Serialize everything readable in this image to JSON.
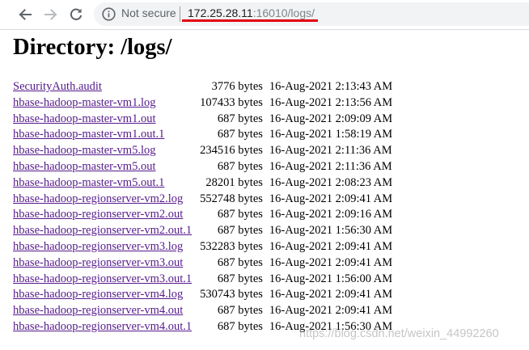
{
  "browser": {
    "security_label": "Not secure",
    "url_host": "172.25.28.11",
    "url_rest": ":16010/logs/"
  },
  "page": {
    "title": "Directory: /logs/"
  },
  "files": [
    {
      "name": "SecurityAuth.audit",
      "size": "3776 bytes",
      "date": "16-Aug-2021 2:13:43 AM"
    },
    {
      "name": "hbase-hadoop-master-vm1.log",
      "size": "107433 bytes",
      "date": "16-Aug-2021 2:13:56 AM"
    },
    {
      "name": "hbase-hadoop-master-vm1.out",
      "size": "687 bytes",
      "date": "16-Aug-2021 2:09:09 AM"
    },
    {
      "name": "hbase-hadoop-master-vm1.out.1",
      "size": "687 bytes",
      "date": "16-Aug-2021 1:58:19 AM"
    },
    {
      "name": "hbase-hadoop-master-vm5.log",
      "size": "234516 bytes",
      "date": "16-Aug-2021 2:11:36 AM"
    },
    {
      "name": "hbase-hadoop-master-vm5.out",
      "size": "687 bytes",
      "date": "16-Aug-2021 2:11:36 AM"
    },
    {
      "name": "hbase-hadoop-master-vm5.out.1",
      "size": "28201 bytes",
      "date": "16-Aug-2021 2:08:23 AM"
    },
    {
      "name": "hbase-hadoop-regionserver-vm2.log",
      "size": "552748 bytes",
      "date": "16-Aug-2021 2:09:41 AM"
    },
    {
      "name": "hbase-hadoop-regionserver-vm2.out",
      "size": "687 bytes",
      "date": "16-Aug-2021 2:09:16 AM"
    },
    {
      "name": "hbase-hadoop-regionserver-vm2.out.1",
      "size": "687 bytes",
      "date": "16-Aug-2021 1:56:30 AM"
    },
    {
      "name": "hbase-hadoop-regionserver-vm3.log",
      "size": "532283 bytes",
      "date": "16-Aug-2021 2:09:41 AM"
    },
    {
      "name": "hbase-hadoop-regionserver-vm3.out",
      "size": "687 bytes",
      "date": "16-Aug-2021 2:09:41 AM"
    },
    {
      "name": "hbase-hadoop-regionserver-vm3.out.1",
      "size": "687 bytes",
      "date": "16-Aug-2021 1:56:00 AM"
    },
    {
      "name": "hbase-hadoop-regionserver-vm4.log",
      "size": "530743 bytes",
      "date": "16-Aug-2021 2:09:41 AM"
    },
    {
      "name": "hbase-hadoop-regionserver-vm4.out",
      "size": "687 bytes",
      "date": "16-Aug-2021 2:09:41 AM"
    },
    {
      "name": "hbase-hadoop-regionserver-vm4.out.1",
      "size": "687 bytes",
      "date": "16-Aug-2021 1:56:30 AM"
    }
  ],
  "watermark": "https://blog.csdn.net/weixin_44992260",
  "icons": {
    "back": "back-arrow-icon",
    "forward": "forward-arrow-icon",
    "reload": "reload-icon",
    "security": "info-icon"
  },
  "colors": {
    "link": "#551a8b",
    "annotation_underline": "#e3000f"
  }
}
